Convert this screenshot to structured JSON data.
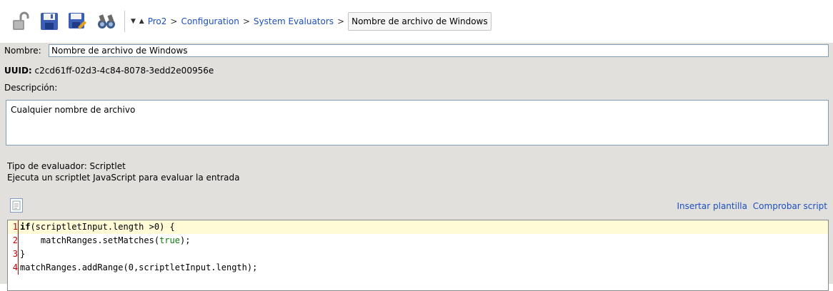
{
  "toolbar": {
    "icons": [
      "unlock-icon",
      "save-icon",
      "save-as-icon",
      "binoculars-icon"
    ],
    "breadcrumb_arrows": "▼ ▲",
    "breadcrumbs": [
      "Pro2",
      "Configuration",
      "System Evaluators"
    ],
    "breadcrumb_sep": ">",
    "current": "Nombre de archivo de Windows"
  },
  "form": {
    "name_label": "Nombre:",
    "name_value": "Nombre de archivo de Windows",
    "uuid_label": "UUID:",
    "uuid_value": "c2cd61ff-02d3-4c84-8078-3edd2e00956e",
    "description_label": "Descripción:",
    "description_value": "Cualquier nombre de archivo",
    "evaluator_type": "Tipo de evaluador: Scriptlet",
    "evaluator_desc": "Ejecuta un scriptlet JavaScript para evaluar la entrada",
    "insert_template": "Insertar plantilla",
    "check_script": "Comprobar script"
  },
  "editor": {
    "lines": [
      {
        "num": "1",
        "kw": "if",
        "rest": "(scriptletInput.length >0) {"
      },
      {
        "num": "2",
        "pre": "    matchRanges.setMatches(",
        "lit": "true",
        "post": ");"
      },
      {
        "num": "3",
        "text": "}"
      },
      {
        "num": "4",
        "text": "matchRanges.addRange(0,scriptletInput.length);"
      }
    ]
  },
  "colors": {
    "link": "#1d4fbf",
    "form_bg": "#e1e0dc",
    "line_highlight": "#fffbd6",
    "literal": "#0a7d0a"
  }
}
